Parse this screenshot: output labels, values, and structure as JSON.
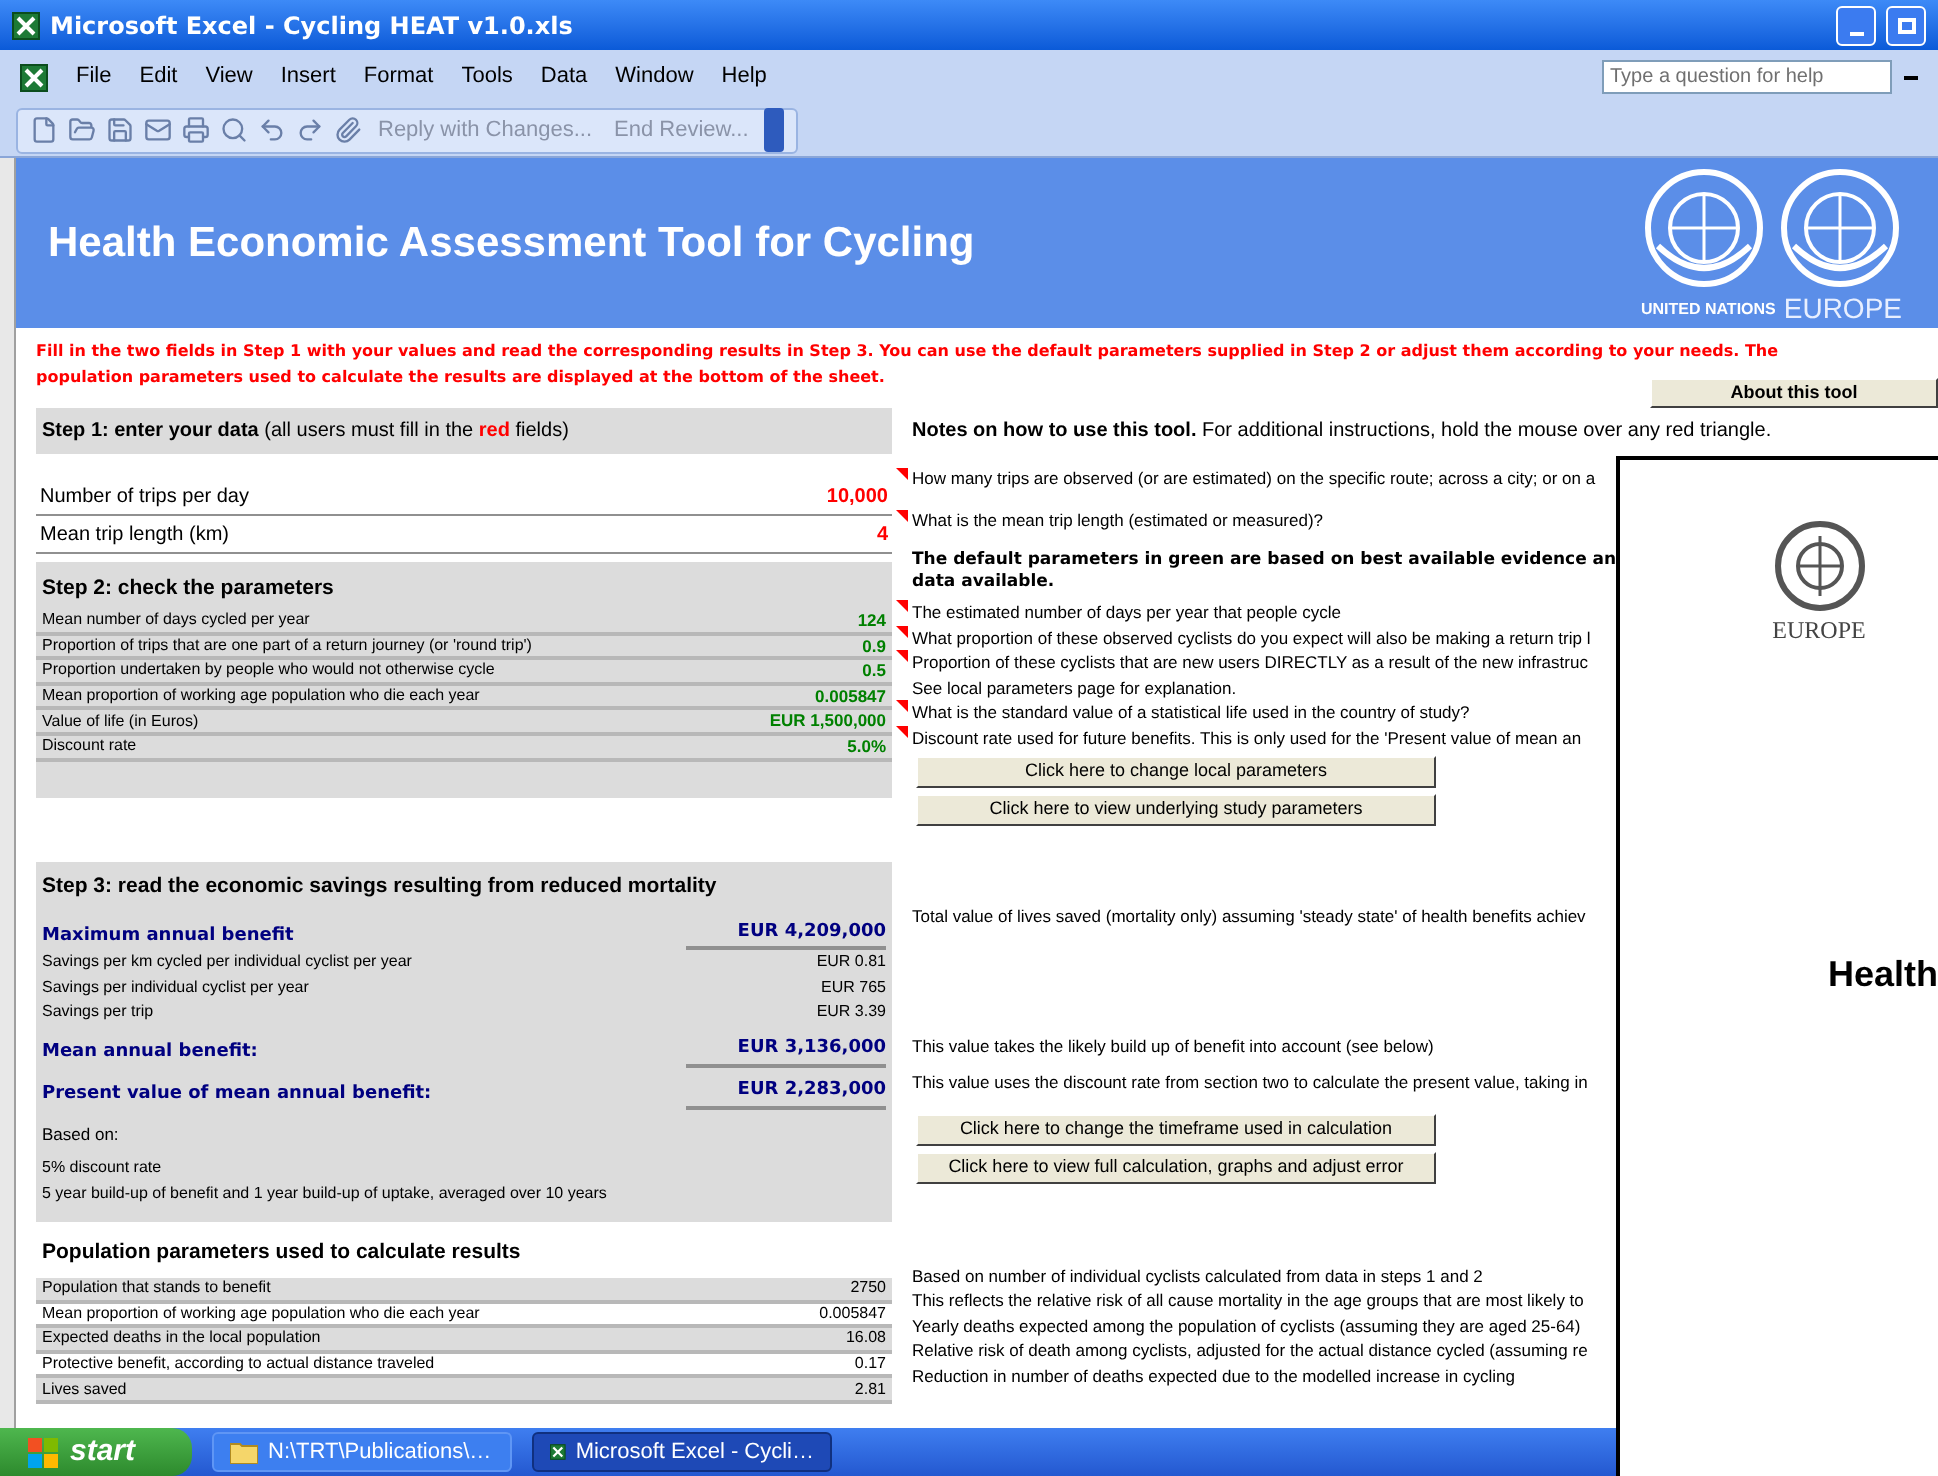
{
  "window": {
    "title": "Microsoft Excel - Cycling HEAT v1.0.xls"
  },
  "menu": [
    "File",
    "Edit",
    "View",
    "Insert",
    "Format",
    "Tools",
    "Data",
    "Window",
    "Help"
  ],
  "help_box": {
    "placeholder": "Type a question for help"
  },
  "toolbar": {
    "buttons": [
      "Reply with Changes...",
      "End Review..."
    ]
  },
  "banner": {
    "title": "Health Economic Assessment Tool for Cycling",
    "captions": [
      "UNITED NATIONS",
      "EUROPE"
    ]
  },
  "instructions": "Fill in the two fields in Step 1 with your values and read the corresponding results in Step 3. You can use the default parameters supplied in Step 2 or adjust them according to your needs.  The population parameters used to calculate the results are displayed at the bottom of the sheet.",
  "about_button": "About this tool",
  "notes": {
    "heading": "Notes on how to use this tool.",
    "text": "For additional instructions, hold the mouse over any red triangle."
  },
  "step1": {
    "heading": "Step 1: enter your data",
    "note_before": "(all users must fill in the",
    "note_highlight": "red",
    "note_after": "fields)",
    "fields": [
      {
        "label": "Number of trips per day",
        "value": "10,000",
        "note": "How many trips are observed (or are estimated) on the specific route; across a city; or on a",
        "comment": true
      },
      {
        "label": "Mean trip length  (km)",
        "value": "4",
        "note": "What is the mean trip length (estimated or measured)?",
        "comment": true
      }
    ]
  },
  "step2": {
    "heading": "Step 2: check the parameters",
    "green_note_lines": [
      "The default parameters in green are based on best available evidence an",
      "data available."
    ],
    "params": [
      {
        "label": "Mean number of days cycled per year",
        "value": "124",
        "note": "The estimated number of days per year that people cycle",
        "comment": true
      },
      {
        "label": "Proportion of trips that are one part of a return journey (or 'round trip')",
        "value": "0.9",
        "note": "What proportion of these observed cyclists do you expect will also be making a return trip l",
        "comment": true
      },
      {
        "label": "Proportion undertaken by people who would not otherwise cycle",
        "value": "0.5",
        "note": "Proportion of these cyclists that are new users DIRECTLY as a result of the new infrastruc",
        "comment": true
      },
      {
        "label": "Mean proportion of working age population who die each year",
        "value": "0.005847",
        "note": "See local parameters page for explanation.",
        "comment": false
      },
      {
        "label": "Value of life (in Euros)",
        "value": "EUR 1,500,000",
        "note": "What is the standard value of a statistical life used in the country of study?",
        "comment": true
      },
      {
        "label": "Discount rate",
        "value": "5.0%",
        "note": "Discount rate used for future benefits.  This is only used for the 'Present value of mean an",
        "comment": true
      }
    ],
    "buttons": [
      "Click here to change local parameters",
      "Click here to view underlying study parameters"
    ]
  },
  "step3": {
    "heading": "Step 3: read the economic savings resulting from reduced mortality",
    "results": [
      {
        "kind": "headline",
        "label": "Maximum annual benefit",
        "value": "EUR 4,209,000",
        "note": "Total value of lives saved (mortality only) assuming 'steady state' of health benefits achiev"
      },
      {
        "kind": "detail",
        "label": "Savings per km cycled per individual cyclist per year",
        "value": "EUR 0.81"
      },
      {
        "kind": "detail",
        "label": "Savings per individual cyclist per year",
        "value": "EUR 765"
      },
      {
        "kind": "detail",
        "label": "Savings per trip",
        "value": "EUR 3.39"
      },
      {
        "kind": "headline",
        "label": "Mean annual benefit:",
        "value": "EUR 3,136,000",
        "note": "This value takes the likely build up of benefit into account (see below)"
      },
      {
        "kind": "headline",
        "label": "Present value of mean annual benefit:",
        "value": "EUR 2,283,000",
        "note": "This value uses the discount rate from section two to calculate the present value, taking in"
      }
    ],
    "based_on": "Based on:",
    "assumptions": [
      "5% discount rate",
      "5 year build-up of benefit and 1 year build-up of uptake, averaged over 10 years"
    ],
    "buttons": [
      "Click here to change the timeframe used in calculation",
      "Click here to view full calculation, graphs and adjust error"
    ]
  },
  "population": {
    "heading": "Population parameters used to calculate results",
    "rows": [
      {
        "label": "Population that stands to benefit",
        "value": "2750",
        "note": "Based on number of individual cyclists calculated from data in steps 1 and 2"
      },
      {
        "label": "Mean proportion of working age population who die each year",
        "value": "0.005847",
        "note": "This reflects the relative risk of all cause mortality in the age groups that are most likely to"
      },
      {
        "label": "Expected deaths in the local population",
        "value": "16.08",
        "note": "Yearly deaths expected among the population of cyclists (assuming they are aged 25-64)"
      },
      {
        "label": "Protective benefit, according to actual distance traveled",
        "value": "0.17",
        "note": "Relative risk of death among cyclists, adjusted for the actual distance cycled (assuming re"
      },
      {
        "label": "Lives saved",
        "value": "2.81",
        "note": "Reduction in number of deaths expected due to the modelled increase in cycling"
      }
    ]
  },
  "overlay": {
    "caption": "EUROPE",
    "heading": "Health"
  },
  "taskbar": {
    "start": "start",
    "tasks": [
      {
        "label": "N:\\TRT\\Publications\\…",
        "kind": "folder",
        "selected": false
      },
      {
        "label": "Microsoft Excel - Cycli…",
        "kind": "excel",
        "selected": true
      }
    ]
  }
}
